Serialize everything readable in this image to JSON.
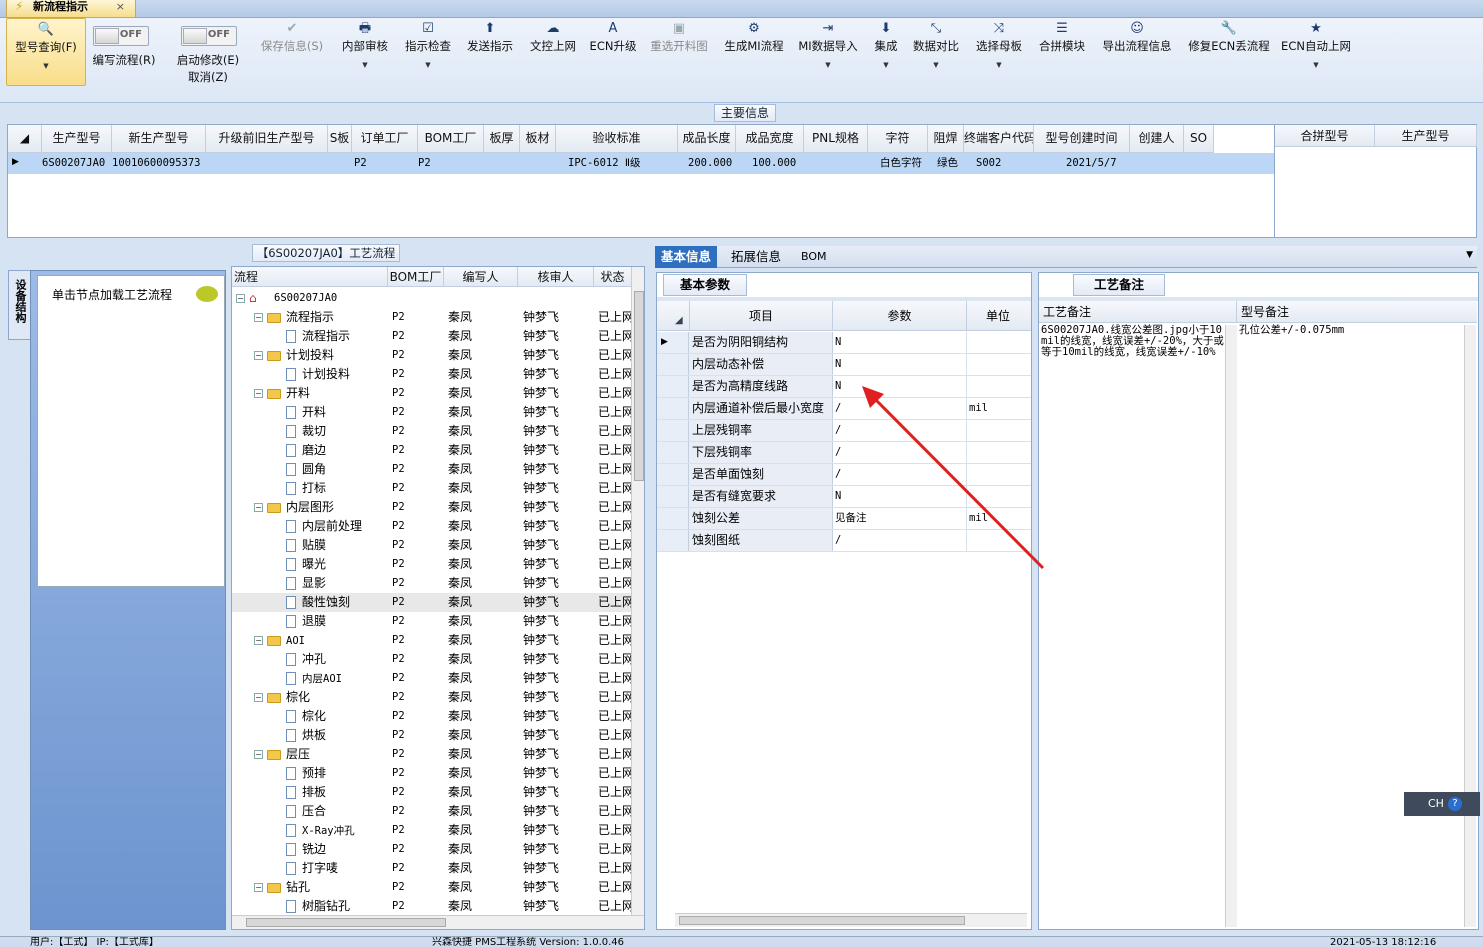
{
  "doc_tab": {
    "title": "新流程指示",
    "close": "×"
  },
  "toolbar": {
    "query": "型号查询(F)",
    "toggle_off": "OFF",
    "write_flow": "编写流程(R)",
    "start_modify": "启动修改(E)",
    "cancel": "取消(Z)",
    "save_info": "保存信息(S)",
    "internal_review": "内部审核",
    "instruction_check": "指示检查",
    "send_instruction": "发送指示",
    "text_control_online": "文控上网",
    "ecn_upgrade": "ECN升级",
    "reselect_cut_chart": "重选开料图",
    "generate_mi_flow": "生成MI流程",
    "mi_data_import": "MI数据导入",
    "integrate": "集成",
    "data_compare": "数据对比",
    "select_mother": "选择母板",
    "merge_module": "合拼模块",
    "export_flow_info": "导出流程信息",
    "fix_ecn_lost_flow": "修复ECN丢流程",
    "ecn_auto_online": "ECN自动上网"
  },
  "main_info": {
    "section_title": "主要信息",
    "columns": [
      "生产型号",
      "新生产型号",
      "升级前旧生产型号",
      "S板",
      "订单工厂",
      "BOM工厂",
      "板厚",
      "板材",
      "验收标准",
      "成品长度",
      "成品宽度",
      "PNL规格",
      "字符",
      "阻焊",
      "终端客户代码",
      "型号创建时间",
      "创建人",
      "SO"
    ],
    "row": {
      "prod_model": "6S00207JA0",
      "new_model": "10010600095373",
      "old_model": "",
      "s_board": "",
      "order_factory": "P2",
      "bom_factory": "P2",
      "thickness": "",
      "material": "",
      "acceptance": "IPC-6012 Ⅱ级",
      "length": "200.000",
      "width": "100.000",
      "pnl": "",
      "char": "白色字符",
      "solder": "绿色",
      "customer_code": "S002",
      "created": "2021/5/7",
      "creator": "",
      "so": ""
    },
    "side_columns": [
      "合拼型号",
      "生产型号"
    ]
  },
  "left_panel": {
    "vtab": "设备结构",
    "hint": "单击节点加载工艺流程"
  },
  "flow_panel": {
    "title": "【6S00207JA0】工艺流程",
    "columns": [
      "流程",
      "BOM工厂",
      "编写人",
      "核审人",
      "状态"
    ],
    "root": "6S00207JA0",
    "rows": [
      {
        "name": "流程指示",
        "level": 1,
        "folder": true,
        "bom": "P2",
        "writer": "秦凤",
        "reviewer": "钟梦飞",
        "status": "已上网"
      },
      {
        "name": "流程指示",
        "level": 2,
        "folder": false,
        "bom": "P2",
        "writer": "秦凤",
        "reviewer": "钟梦飞",
        "status": "已上网"
      },
      {
        "name": "计划投料",
        "level": 1,
        "folder": true,
        "bom": "P2",
        "writer": "秦凤",
        "reviewer": "钟梦飞",
        "status": "已上网"
      },
      {
        "name": "计划投料",
        "level": 2,
        "folder": false,
        "bom": "P2",
        "writer": "秦凤",
        "reviewer": "钟梦飞",
        "status": "已上网"
      },
      {
        "name": "开料",
        "level": 1,
        "folder": true,
        "bom": "P2",
        "writer": "秦凤",
        "reviewer": "钟梦飞",
        "status": "已上网"
      },
      {
        "name": "开料",
        "level": 2,
        "folder": false,
        "bom": "P2",
        "writer": "秦凤",
        "reviewer": "钟梦飞",
        "status": "已上网"
      },
      {
        "name": "裁切",
        "level": 2,
        "folder": false,
        "bom": "P2",
        "writer": "秦凤",
        "reviewer": "钟梦飞",
        "status": "已上网"
      },
      {
        "name": "磨边",
        "level": 2,
        "folder": false,
        "bom": "P2",
        "writer": "秦凤",
        "reviewer": "钟梦飞",
        "status": "已上网"
      },
      {
        "name": "圆角",
        "level": 2,
        "folder": false,
        "bom": "P2",
        "writer": "秦凤",
        "reviewer": "钟梦飞",
        "status": "已上网"
      },
      {
        "name": "打标",
        "level": 2,
        "folder": false,
        "bom": "P2",
        "writer": "秦凤",
        "reviewer": "钟梦飞",
        "status": "已上网"
      },
      {
        "name": "内层图形",
        "level": 1,
        "folder": true,
        "bom": "P2",
        "writer": "秦凤",
        "reviewer": "钟梦飞",
        "status": "已上网"
      },
      {
        "name": "内层前处理",
        "level": 2,
        "folder": false,
        "bom": "P2",
        "writer": "秦凤",
        "reviewer": "钟梦飞",
        "status": "已上网"
      },
      {
        "name": "贴膜",
        "level": 2,
        "folder": false,
        "bom": "P2",
        "writer": "秦凤",
        "reviewer": "钟梦飞",
        "status": "已上网"
      },
      {
        "name": "曝光",
        "level": 2,
        "folder": false,
        "bom": "P2",
        "writer": "秦凤",
        "reviewer": "钟梦飞",
        "status": "已上网"
      },
      {
        "name": "显影",
        "level": 2,
        "folder": false,
        "bom": "P2",
        "writer": "秦凤",
        "reviewer": "钟梦飞",
        "status": "已上网"
      },
      {
        "name": "酸性蚀刻",
        "level": 2,
        "folder": false,
        "bom": "P2",
        "writer": "秦凤",
        "reviewer": "钟梦飞",
        "status": "已上网",
        "selected": true
      },
      {
        "name": "退膜",
        "level": 2,
        "folder": false,
        "bom": "P2",
        "writer": "秦凤",
        "reviewer": "钟梦飞",
        "status": "已上网"
      },
      {
        "name": "AOI",
        "level": 1,
        "folder": true,
        "bom": "P2",
        "writer": "秦凤",
        "reviewer": "钟梦飞",
        "status": "已上网"
      },
      {
        "name": "冲孔",
        "level": 2,
        "folder": false,
        "bom": "P2",
        "writer": "秦凤",
        "reviewer": "钟梦飞",
        "status": "已上网"
      },
      {
        "name": "内层AOI",
        "level": 2,
        "folder": false,
        "bom": "P2",
        "writer": "秦凤",
        "reviewer": "钟梦飞",
        "status": "已上网"
      },
      {
        "name": "棕化",
        "level": 1,
        "folder": true,
        "bom": "P2",
        "writer": "秦凤",
        "reviewer": "钟梦飞",
        "status": "已上网"
      },
      {
        "name": "棕化",
        "level": 2,
        "folder": false,
        "bom": "P2",
        "writer": "秦凤",
        "reviewer": "钟梦飞",
        "status": "已上网"
      },
      {
        "name": "烘板",
        "level": 2,
        "folder": false,
        "bom": "P2",
        "writer": "秦凤",
        "reviewer": "钟梦飞",
        "status": "已上网"
      },
      {
        "name": "层压",
        "level": 1,
        "folder": true,
        "bom": "P2",
        "writer": "秦凤",
        "reviewer": "钟梦飞",
        "status": "已上网"
      },
      {
        "name": "预排",
        "level": 2,
        "folder": false,
        "bom": "P2",
        "writer": "秦凤",
        "reviewer": "钟梦飞",
        "status": "已上网"
      },
      {
        "name": "排板",
        "level": 2,
        "folder": false,
        "bom": "P2",
        "writer": "秦凤",
        "reviewer": "钟梦飞",
        "status": "已上网"
      },
      {
        "name": "压合",
        "level": 2,
        "folder": false,
        "bom": "P2",
        "writer": "秦凤",
        "reviewer": "钟梦飞",
        "status": "已上网"
      },
      {
        "name": "X-Ray冲孔",
        "level": 2,
        "folder": false,
        "bom": "P2",
        "writer": "秦凤",
        "reviewer": "钟梦飞",
        "status": "已上网"
      },
      {
        "name": "铣边",
        "level": 2,
        "folder": false,
        "bom": "P2",
        "writer": "秦凤",
        "reviewer": "钟梦飞",
        "status": "已上网"
      },
      {
        "name": "打字唛",
        "level": 2,
        "folder": false,
        "bom": "P2",
        "writer": "秦凤",
        "reviewer": "钟梦飞",
        "status": "已上网"
      },
      {
        "name": "钻孔",
        "level": 1,
        "folder": true,
        "bom": "P2",
        "writer": "秦凤",
        "reviewer": "钟梦飞",
        "status": "已上网"
      },
      {
        "name": "树脂钻孔",
        "level": 2,
        "folder": false,
        "bom": "P2",
        "writer": "秦凤",
        "reviewer": "钟梦飞",
        "status": "已上网"
      }
    ]
  },
  "info_tabs": [
    "基本信息",
    "拓展信息",
    "BOM"
  ],
  "basic_params": {
    "title": "基本参数",
    "columns": [
      "项目",
      "参数",
      "单位"
    ],
    "rows": [
      {
        "item": "是否为阴阳铜结构",
        "value": "N",
        "unit": ""
      },
      {
        "item": "内层动态补偿",
        "value": "N",
        "unit": ""
      },
      {
        "item": "是否为高精度线路",
        "value": "N",
        "unit": ""
      },
      {
        "item": "内层通道补偿后最小宽度",
        "value": "/",
        "unit": "mil"
      },
      {
        "item": "上层残铜率",
        "value": "/",
        "unit": ""
      },
      {
        "item": "下层残铜率",
        "value": "/",
        "unit": ""
      },
      {
        "item": "是否单面蚀刻",
        "value": "/",
        "unit": ""
      },
      {
        "item": "是否有缝宽要求",
        "value": "N",
        "unit": ""
      },
      {
        "item": "蚀刻公差",
        "value": "见备注",
        "unit": "mil"
      },
      {
        "item": "蚀刻图纸",
        "value": "/",
        "unit": ""
      }
    ]
  },
  "process_note": {
    "title": "工艺备注",
    "col1": "工艺备注",
    "col2": "型号备注",
    "note1": "6S00207JA0.线宽公差图.jpg小于10mil的线宽，线宽误差+/-20%，大于或等于10mil的线宽，线宽误差+/-10%",
    "note2": "孔位公差+/-0.075mm"
  },
  "ime": {
    "label": "CH"
  },
  "status": {
    "left": "用户:【工式】  IP:【工式库】",
    "center": "兴森快捷  PMS工程系统  Version: 1.0.0.46",
    "right": "2021-05-13  18:12:16"
  },
  "colors": {
    "accent": "#2f6fc0",
    "selection": "#cfe2f8",
    "arrow": "#e02020"
  }
}
